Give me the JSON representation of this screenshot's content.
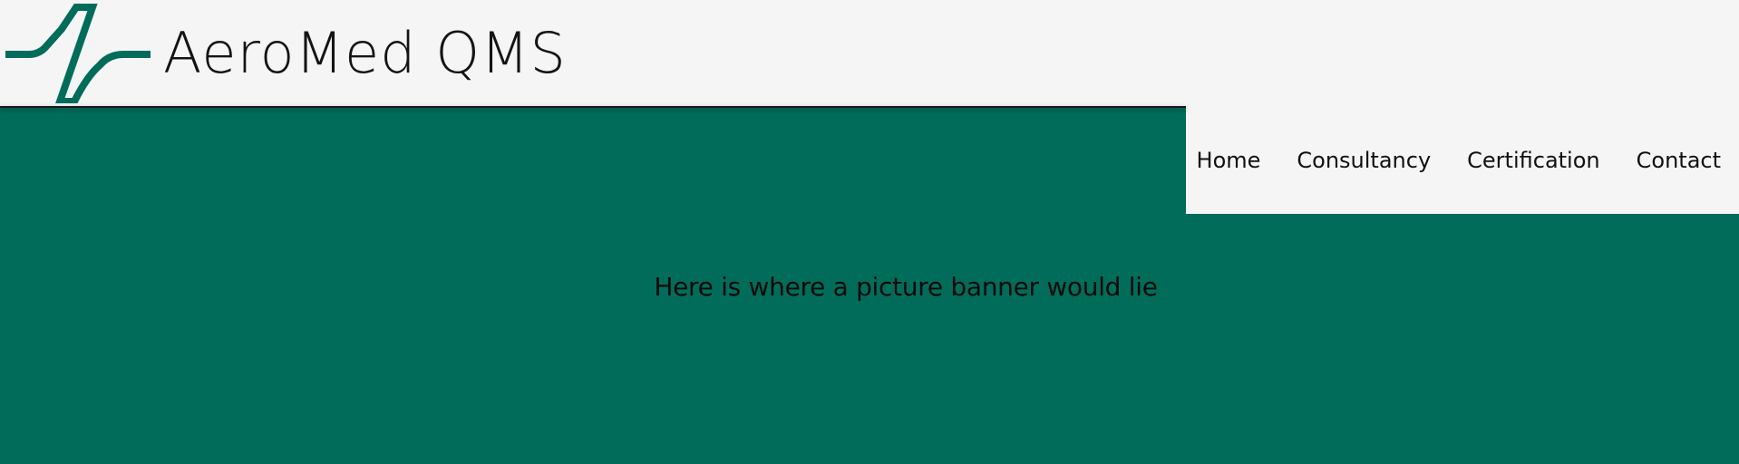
{
  "brand": {
    "name": "AeroMed QMS",
    "logo_icon": "ekg-pulse-icon",
    "accent_color": "#026c5a"
  },
  "nav": {
    "items": [
      {
        "label": "Home"
      },
      {
        "label": "Consultancy"
      },
      {
        "label": "Certification"
      },
      {
        "label": "Contact"
      }
    ]
  },
  "banner": {
    "placeholder_text": "Here is where a picture banner would lie",
    "background_color": "#026c5a"
  }
}
